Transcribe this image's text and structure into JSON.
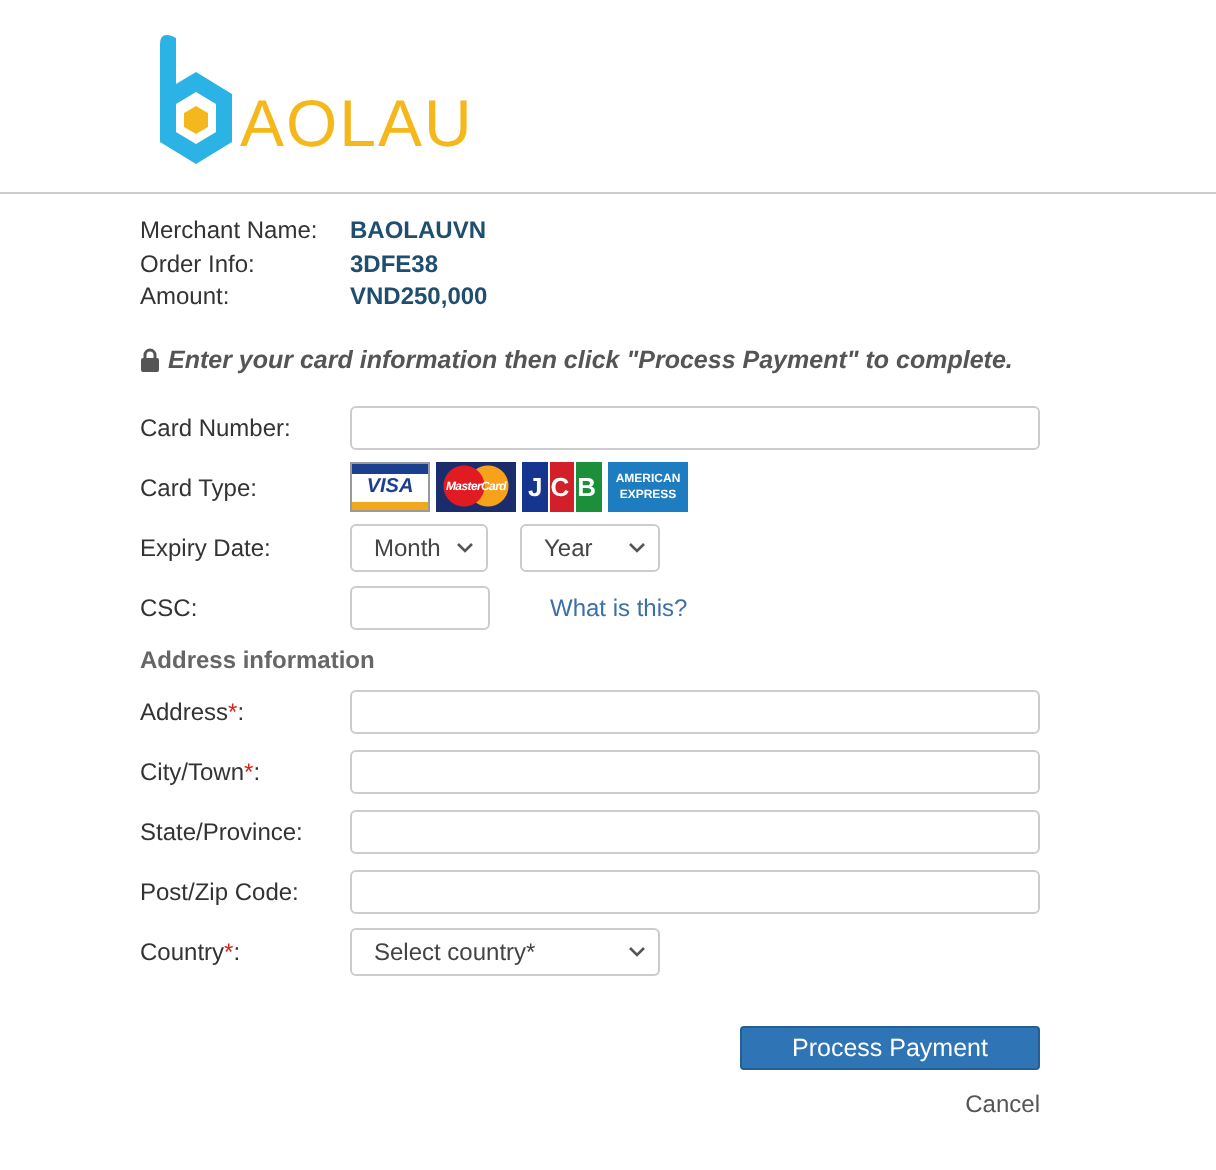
{
  "logo": {
    "text": "AOLAU"
  },
  "order": [
    {
      "label": "Merchant Name:",
      "value": "BAOLAUVN"
    },
    {
      "label": "Order Info:",
      "value": "3DFE38"
    },
    {
      "label": "Amount:",
      "value": "VND250,000"
    }
  ],
  "notice": "Enter your card information then click \"Process Payment\" to complete.",
  "card_fields": [
    {
      "kind": "text",
      "label": "Card Number:"
    },
    {
      "kind": "cards",
      "label": "Card Type:",
      "cards": [
        {
          "kind": "visa",
          "text": "VISA"
        },
        {
          "kind": "mastercard",
          "text": "MasterCard"
        },
        {
          "kind": "jcb",
          "text": "JCB"
        },
        {
          "kind": "amex",
          "text": "AMERICAN EXPRESS"
        }
      ]
    },
    {
      "kind": "expiry",
      "label": "Expiry Date:",
      "selects": [
        "Month",
        "Year"
      ]
    },
    {
      "kind": "csc",
      "label": "CSC:",
      "link": "What is this?"
    }
  ],
  "address_heading": "Address information",
  "address_fields": [
    {
      "kind": "text",
      "label": "Address",
      "required_mark": "*",
      "suffix": ":"
    },
    {
      "kind": "text",
      "label": "City/Town",
      "required_mark": "*",
      "suffix": ":"
    },
    {
      "kind": "text",
      "label": "State/Province:"
    },
    {
      "kind": "text",
      "label": "Post/Zip Code:"
    },
    {
      "kind": "select",
      "label": "Country",
      "required_mark": "*",
      "suffix": ":",
      "placeholder": "Select country*"
    }
  ],
  "submit": "Process Payment",
  "cancel": "Cancel"
}
